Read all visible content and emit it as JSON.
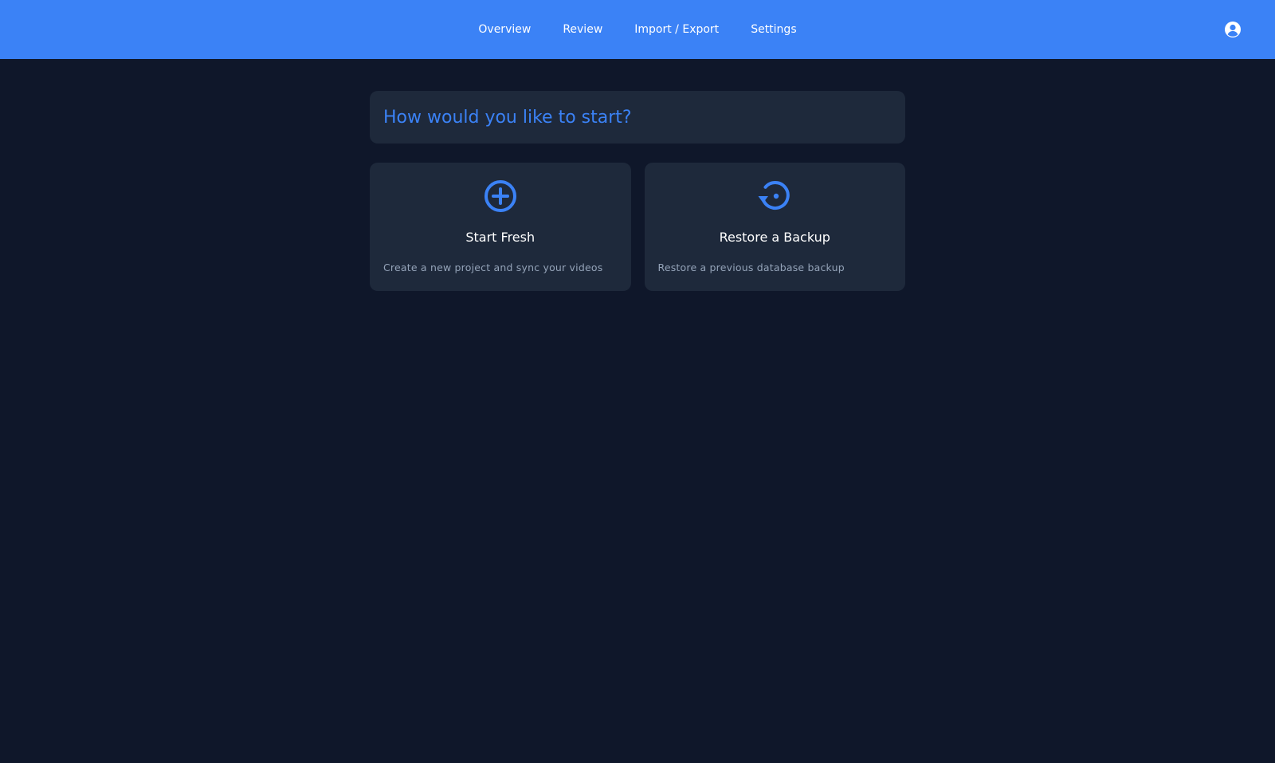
{
  "nav": {
    "items": [
      {
        "label": "Overview"
      },
      {
        "label": "Review"
      },
      {
        "label": "Import / Export"
      },
      {
        "label": "Settings"
      }
    ],
    "user_icon": "user-circle-icon"
  },
  "main": {
    "prompt_title": "How would you like to start?",
    "options": [
      {
        "icon": "plus-circle-icon",
        "title": "Start Fresh",
        "description": "Create a new project and sync your videos"
      },
      {
        "icon": "restore-history-icon",
        "title": "Restore a Backup",
        "description": "Restore a previous database backup"
      }
    ]
  },
  "colors": {
    "header_bg": "#3b82f6",
    "page_bg": "#0f172a",
    "card_bg": "#1e293b",
    "accent": "#3b82f6",
    "muted_text": "#94a3b8"
  }
}
